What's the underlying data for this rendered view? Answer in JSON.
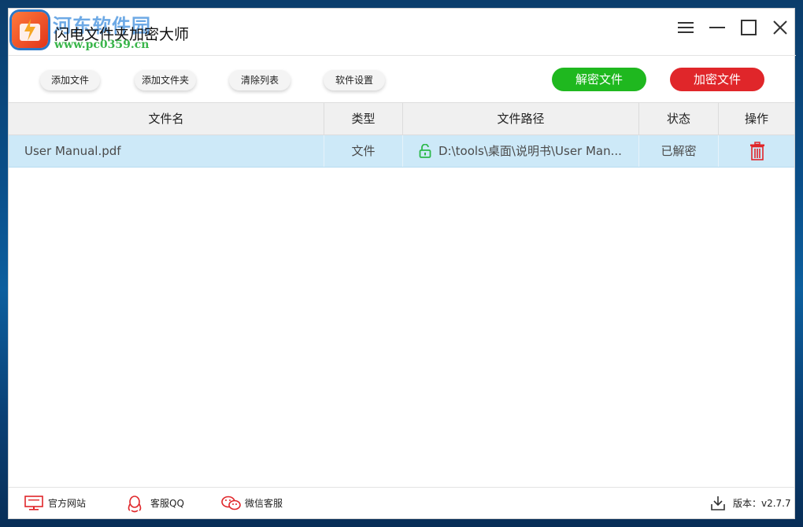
{
  "window": {
    "title": "闪电文件夹加密大师",
    "watermark_name": "河东软件园",
    "watermark_url": "www.pc0359.cn"
  },
  "window_controls": {
    "menu_icon": "hamburger-icon",
    "minimize_icon": "minimize-icon",
    "maximize_icon": "maximize-icon",
    "close_icon": "close-icon"
  },
  "toolbar": {
    "add_file": "添加文件",
    "add_folder": "添加文件夹",
    "clear_list": "清除列表",
    "settings": "软件设置",
    "decrypt": "解密文件",
    "encrypt": "加密文件"
  },
  "colors": {
    "decrypt_button": "#1fb81f",
    "encrypt_button": "#e0262a",
    "selected_row": "#cde9f8",
    "unlock_icon": "#2db84a",
    "delete_icon": "#e0262a"
  },
  "table": {
    "headers": {
      "name": "文件名",
      "type": "类型",
      "path": "文件路径",
      "status": "状态",
      "action": "操作"
    },
    "rows": [
      {
        "name": "User Manual.pdf",
        "type": "文件",
        "path": "D:\\tools\\桌面\\说明书\\User Man...",
        "status": "已解密",
        "lock_icon": "unlock-icon",
        "action_icon": "trash-icon"
      }
    ]
  },
  "footer": {
    "website": "官方网站",
    "qq": "客服QQ",
    "wechat": "微信客服",
    "version": "版本：v2.7.7"
  }
}
